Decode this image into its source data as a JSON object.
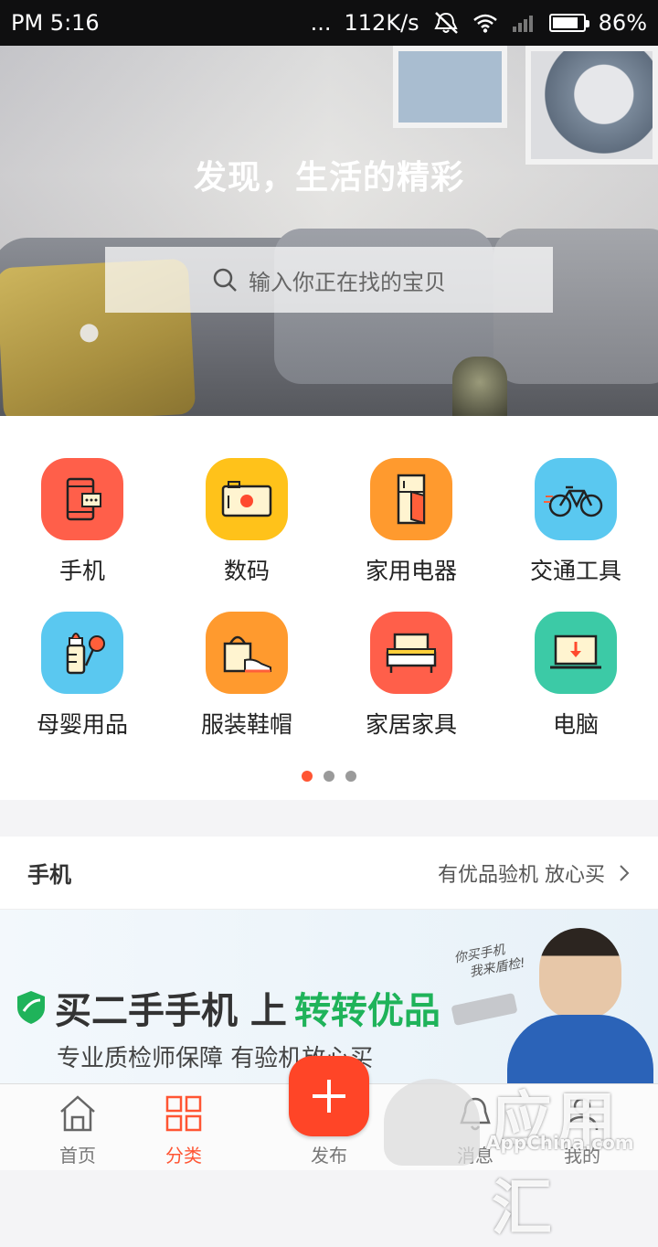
{
  "status_bar": {
    "time": "PM 5:16",
    "dots": "...",
    "speed": "112K/s",
    "battery": "86%",
    "battery_level": 0.86
  },
  "hero": {
    "title": "发现，生活的精彩",
    "search_placeholder": "输入你正在找的宝贝"
  },
  "categories": [
    {
      "label": "手机",
      "icon": "phone-icon",
      "color": "#ff5f4a"
    },
    {
      "label": "数码",
      "icon": "camera-icon",
      "color": "#ffc21a"
    },
    {
      "label": "家用电器",
      "icon": "fridge-icon",
      "color": "#ff9a2e"
    },
    {
      "label": "交通工具",
      "icon": "bicycle-icon",
      "color": "#5ac8f0"
    },
    {
      "label": "母婴用品",
      "icon": "baby-bottle-icon",
      "color": "#5ac8f0"
    },
    {
      "label": "服装鞋帽",
      "icon": "bag-shoe-icon",
      "color": "#ff9a2e"
    },
    {
      "label": "家居家具",
      "icon": "bed-icon",
      "color": "#ff5f4a"
    },
    {
      "label": "电脑",
      "icon": "laptop-icon",
      "color": "#3ccaa6"
    }
  ],
  "pager": {
    "count": 3,
    "active": 0
  },
  "section": {
    "title": "手机",
    "subtitle": "有优品验机 放心买"
  },
  "banner": {
    "main_prefix": "买二手手机 上",
    "main_highlight": "转转优品",
    "sub": "专业质检师保障 有验机放心买",
    "note_line1": "你买手机",
    "note_line2": "我来盾检!"
  },
  "tabs": {
    "home": "首页",
    "category": "分类",
    "publish": "发布",
    "messages": "消息",
    "mine": "我的"
  },
  "watermark": {
    "big": "应用汇",
    "small": "AppChina.com"
  },
  "colors": {
    "accent": "#ff5533",
    "green": "#1fb35a"
  }
}
